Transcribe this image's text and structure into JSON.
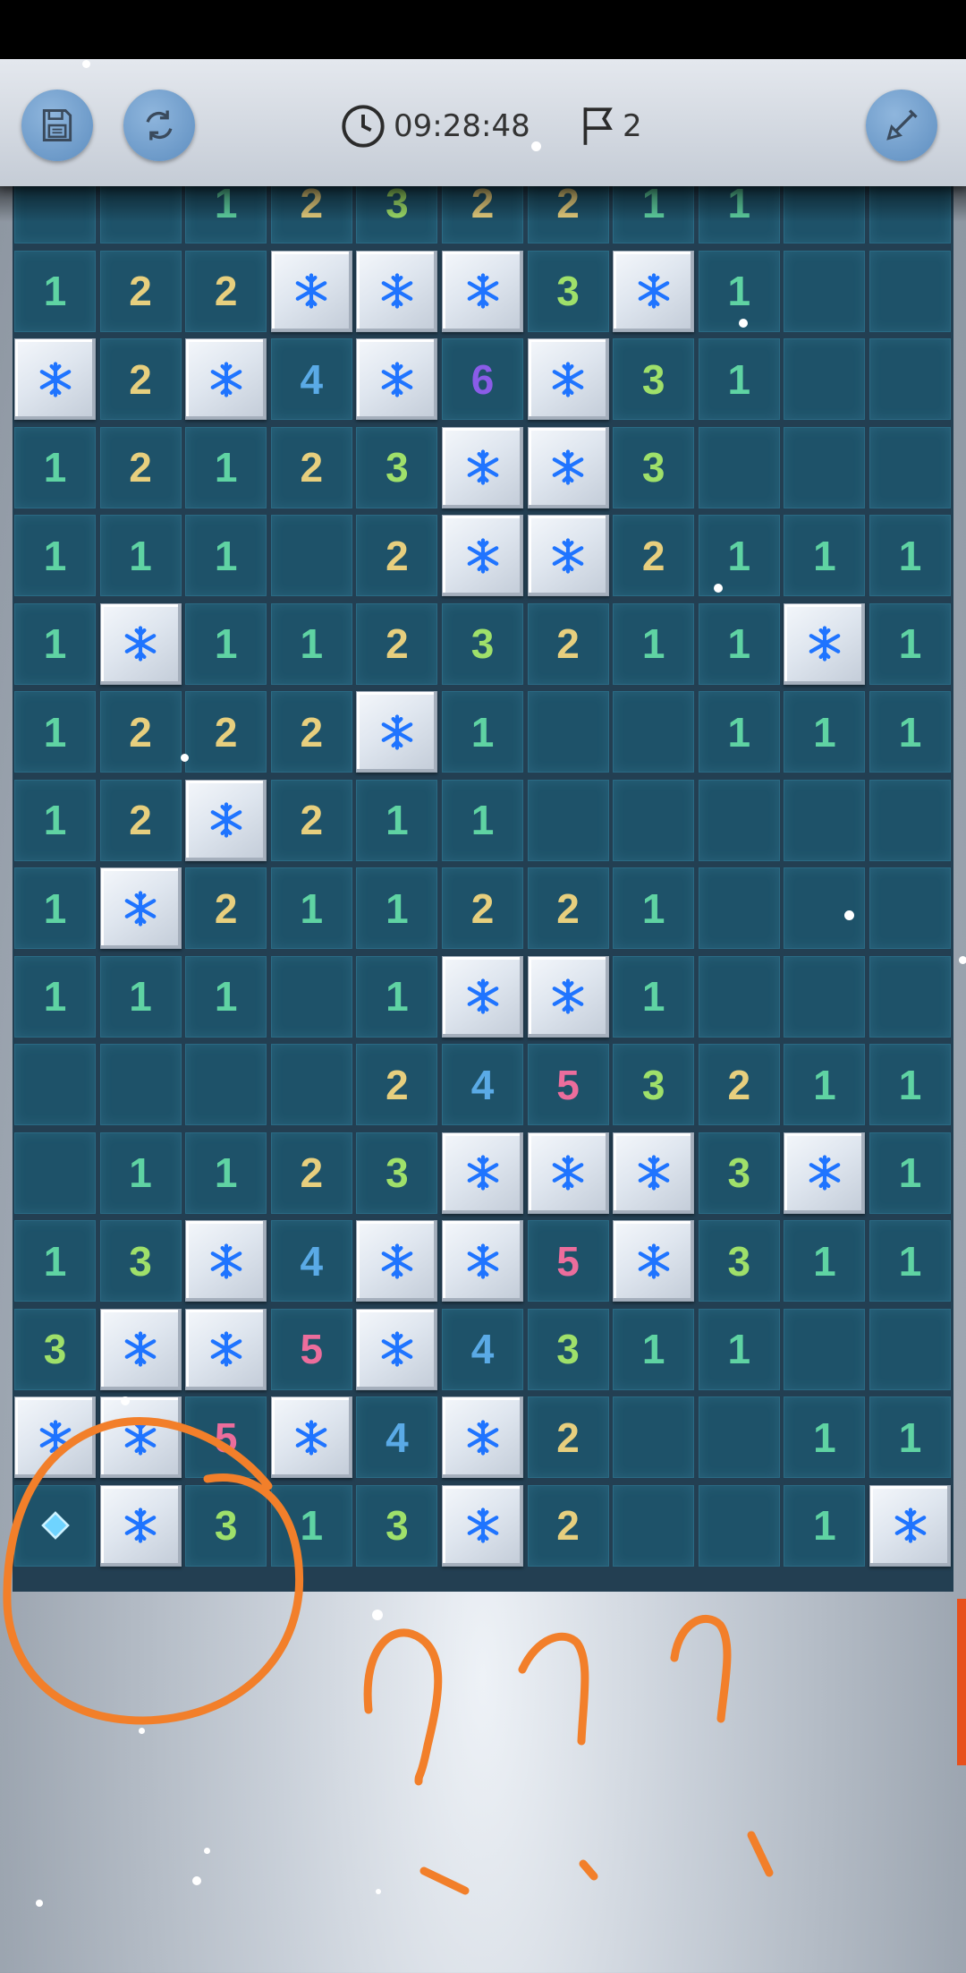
{
  "header": {
    "timer": "09:28:48",
    "flag_count": "2",
    "buttons": {
      "save": "save-icon",
      "restart": "refresh-icon",
      "dig": "shovel-icon"
    }
  },
  "colors": {
    "n1": "#5fd3a3",
    "n2": "#e7cf7e",
    "n3": "#9fe06a",
    "n4": "#5aaae6",
    "n5": "#ec6d9c",
    "n6": "#8a5ce8",
    "flag_snowflake": "#1f74ff",
    "annotation": "#f27f2a"
  },
  "board": {
    "cols": 11,
    "legend": "'' = revealed empty, digits = neighbouring mine count, F = snowflake-flagged tile, D = diamond marker",
    "rows": [
      [
        "",
        "",
        "1",
        "2",
        "3",
        "2",
        "2",
        "1",
        "1",
        "",
        ""
      ],
      [
        "1",
        "2",
        "2",
        "F",
        "F",
        "F",
        "3",
        "F",
        "1",
        "",
        ""
      ],
      [
        "F",
        "2",
        "F",
        "4",
        "F",
        "6",
        "F",
        "3",
        "1",
        "",
        ""
      ],
      [
        "1",
        "2",
        "1",
        "2",
        "3",
        "F",
        "F",
        "3",
        "",
        "",
        ""
      ],
      [
        "1",
        "1",
        "1",
        "",
        "2",
        "F",
        "F",
        "2",
        "1",
        "1",
        "1"
      ],
      [
        "1",
        "F",
        "1",
        "1",
        "2",
        "3",
        "2",
        "1",
        "1",
        "F",
        "1"
      ],
      [
        "1",
        "2",
        "2",
        "2",
        "F",
        "1",
        "",
        "",
        "1",
        "1",
        "1"
      ],
      [
        "1",
        "2",
        "F",
        "2",
        "1",
        "1",
        "",
        "",
        "",
        "",
        ""
      ],
      [
        "1",
        "F",
        "2",
        "1",
        "1",
        "2",
        "2",
        "1",
        "",
        "",
        ""
      ],
      [
        "1",
        "1",
        "1",
        "",
        "1",
        "F",
        "F",
        "1",
        "",
        "",
        ""
      ],
      [
        "",
        "",
        "",
        "",
        "2",
        "4",
        "5",
        "3",
        "2",
        "1",
        "1"
      ],
      [
        "",
        "1",
        "1",
        "2",
        "3",
        "F",
        "F",
        "F",
        "3",
        "F",
        "1"
      ],
      [
        "1",
        "3",
        "F",
        "4",
        "F",
        "F",
        "5",
        "F",
        "3",
        "1",
        "1"
      ],
      [
        "3",
        "F",
        "F",
        "5",
        "F",
        "4",
        "3",
        "1",
        "1",
        "",
        ""
      ],
      [
        "F",
        "F",
        "5",
        "F",
        "4",
        "F",
        "2",
        "",
        "",
        "1",
        "1"
      ],
      [
        "D",
        "F",
        "3",
        "1",
        "3",
        "F",
        "2",
        "",
        "",
        "1",
        "F"
      ]
    ]
  },
  "annotation": {
    "type": "hand-drawn circle around bottom-left cells and three question marks"
  }
}
